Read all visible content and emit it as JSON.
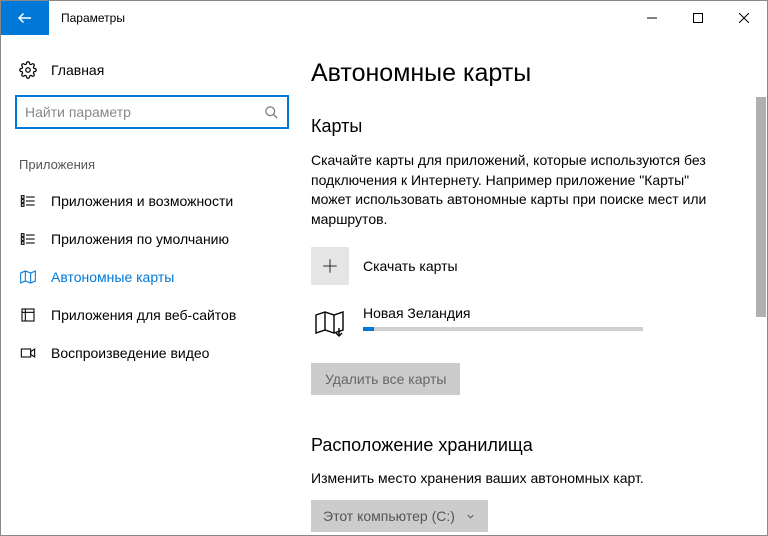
{
  "window": {
    "title": "Параметры"
  },
  "sidebar": {
    "home": "Главная",
    "search_placeholder": "Найти параметр",
    "section": "Приложения",
    "items": [
      {
        "label": "Приложения и возможности"
      },
      {
        "label": "Приложения по умолчанию"
      },
      {
        "label": "Автономные карты"
      },
      {
        "label": "Приложения для веб-сайтов"
      },
      {
        "label": "Воспроизведение видео"
      }
    ]
  },
  "main": {
    "heading": "Автономные карты",
    "maps_heading": "Карты",
    "maps_desc": "Скачайте карты для приложений, которые используются без подключения к Интернету. Например приложение \"Карты\" может использовать автономные карты при поиске мест или маршрутов.",
    "download_label": "Скачать карты",
    "map_entry": {
      "name": "Новая Зеландия"
    },
    "delete_all": "Удалить все карты",
    "storage_heading": "Расположение хранилища",
    "storage_desc": "Изменить место хранения ваших автономных карт.",
    "storage_dropdown": "Этот компьютер (C:)"
  }
}
